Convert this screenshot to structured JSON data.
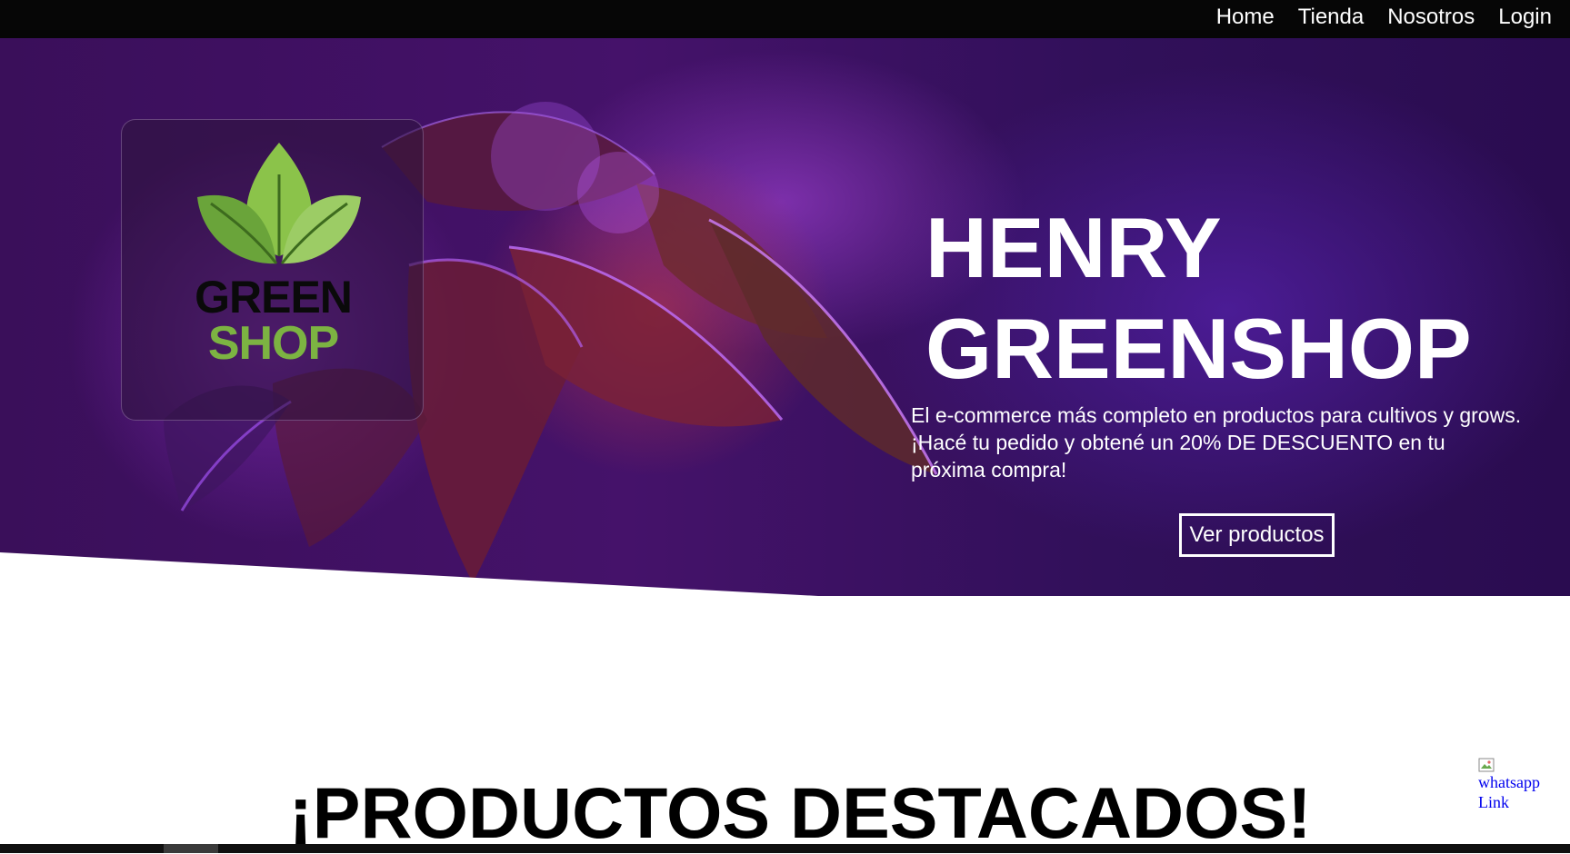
{
  "nav": {
    "items": [
      {
        "label": "Home"
      },
      {
        "label": "Tienda"
      },
      {
        "label": "Nosotros"
      },
      {
        "label": "Login"
      }
    ]
  },
  "hero": {
    "logo": {
      "word_top": "GREEN",
      "word_bottom": "SHOP",
      "icon": "leaves-logo-icon",
      "colors": {
        "leaf_dark": "#6aa43a",
        "leaf_light": "#9ccc65",
        "text_dark": "#0a0a0a",
        "text_green": "#7cb342"
      }
    },
    "title_line1": "HENRY",
    "title_line2": "GREENSHOP",
    "subtitle_line1": "El e-commerce más completo en productos para cultivos y grows.",
    "subtitle_line2": "¡Hacé tu pedido y obtené un 20% DE DESCUENTO en tu",
    "subtitle_line3": "próxima compra!",
    "cta_label": "Ver productos"
  },
  "featured": {
    "title": "¡PRODUCTOS DESTACADOS!"
  },
  "whatsapp": {
    "alt_text": "whatsapp Link",
    "icon": "broken-image-icon"
  },
  "colors": {
    "navbar_bg": "#060606",
    "hero_purple": "#3a0f5a",
    "text_white": "#ffffff",
    "link_blue": "#0000ee"
  }
}
